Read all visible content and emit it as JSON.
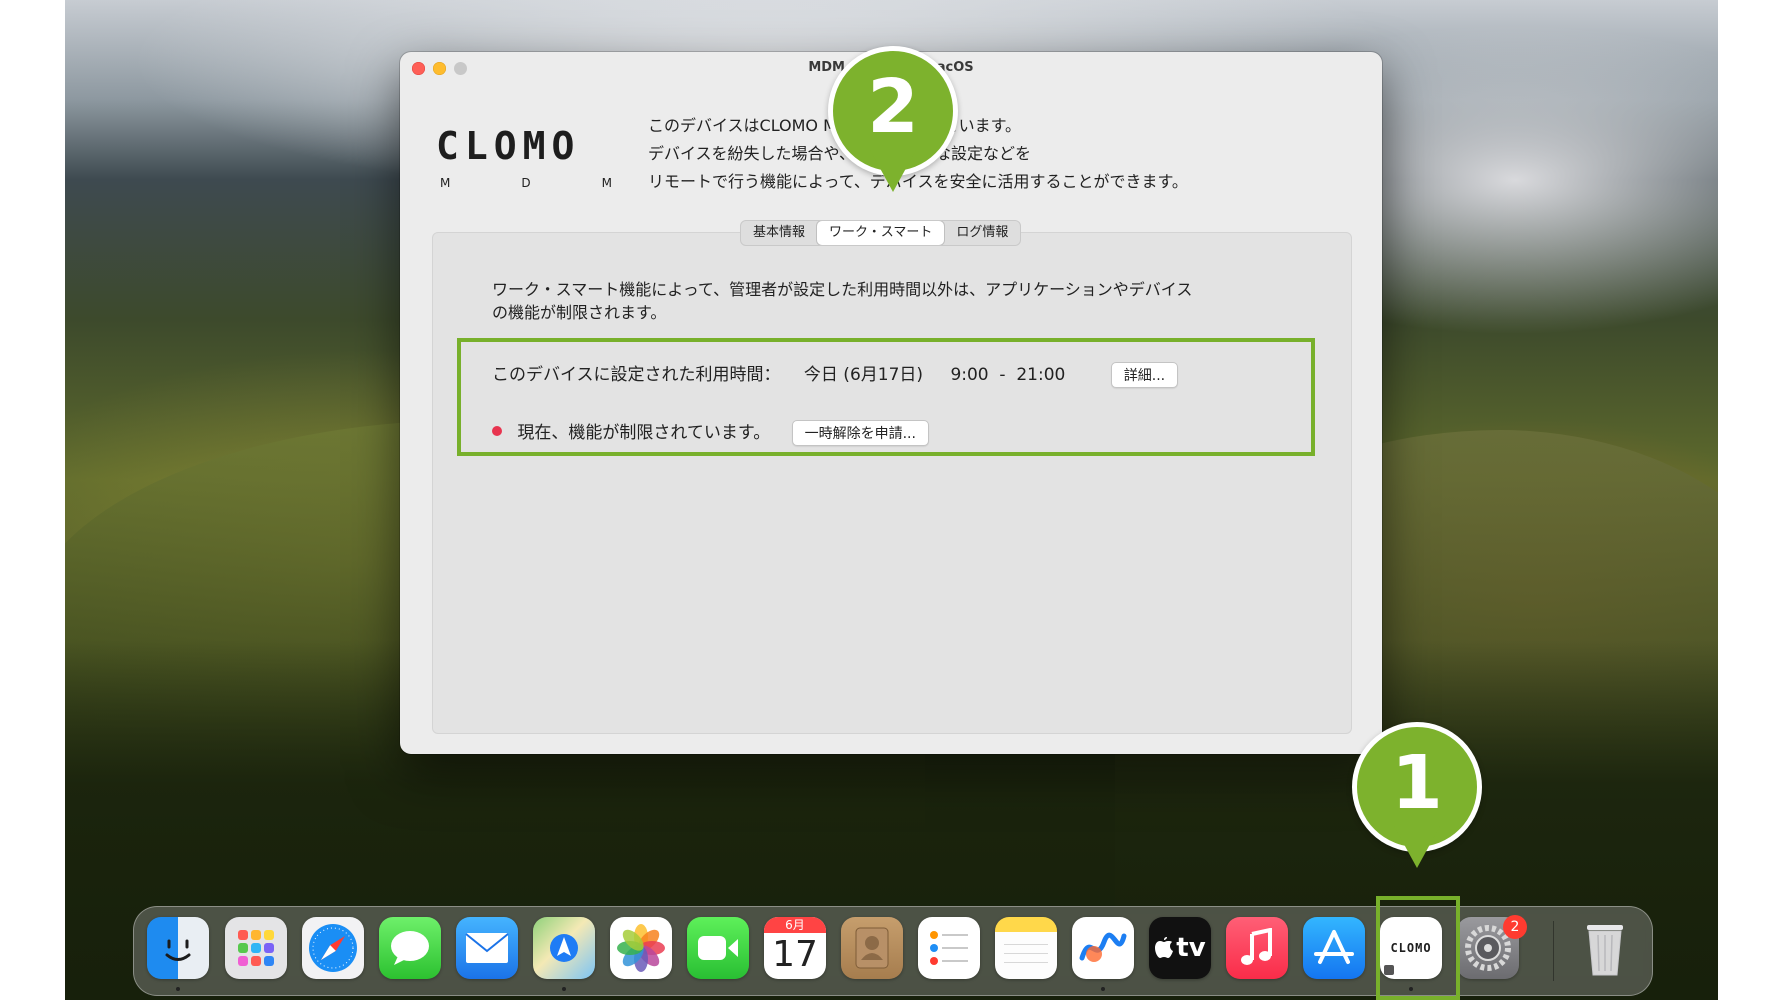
{
  "window": {
    "title": "MDM Agent for macOS"
  },
  "logo": {
    "word": "CLOMO",
    "sub": [
      "M",
      "D",
      "M"
    ]
  },
  "intro_lines": [
    "このデバイスはCLOMO MDMで管理されています。",
    "デバイスを紛失した場合や、組織で必要な設定などを",
    "リモートで行う機能によって、デバイスを安全に活用することができます。"
  ],
  "tabs": [
    {
      "label": "基本情報",
      "active": false
    },
    {
      "label": "ワーク・スマート",
      "active": true
    },
    {
      "label": "ログ情報",
      "active": false
    }
  ],
  "work_smart": {
    "description_lines": [
      "ワーク・スマート機能によって、管理者が設定した利用時間以外は、アプリケーションやデバイス",
      "の機能が制限されます。"
    ],
    "schedule_label": "このデバイスに設定された利用時間：",
    "schedule_date": "今日 (6月17日)",
    "schedule_time": "9:00  -  21:00",
    "details_button": "詳細...",
    "status_text": "現在、機能が制限されています。",
    "status_color": "#e8344f",
    "request_button": "一時解除を申請..."
  },
  "callouts": [
    {
      "number": "1",
      "color": "#7db22d"
    },
    {
      "number": "2",
      "color": "#7db22d"
    }
  ],
  "highlight_color": "#78b02b",
  "dock": {
    "items": [
      {
        "name": "finder-icon"
      },
      {
        "name": "launchpad-icon"
      },
      {
        "name": "safari-icon"
      },
      {
        "name": "messages-icon"
      },
      {
        "name": "mail-icon"
      },
      {
        "name": "maps-icon"
      },
      {
        "name": "photos-icon"
      },
      {
        "name": "facetime-icon"
      },
      {
        "name": "calendar-icon",
        "month": "6月",
        "day": "17"
      },
      {
        "name": "contacts-icon"
      },
      {
        "name": "reminders-icon"
      },
      {
        "name": "notes-icon"
      },
      {
        "name": "freeform-icon"
      },
      {
        "name": "apple-tv-icon",
        "label": "tv"
      },
      {
        "name": "music-icon"
      },
      {
        "name": "app-store-icon"
      },
      {
        "name": "clomo-agent-icon",
        "label": "CLOMO"
      },
      {
        "name": "system-settings-icon"
      },
      {
        "name": "trash-icon"
      }
    ],
    "settings_badge": "2"
  }
}
